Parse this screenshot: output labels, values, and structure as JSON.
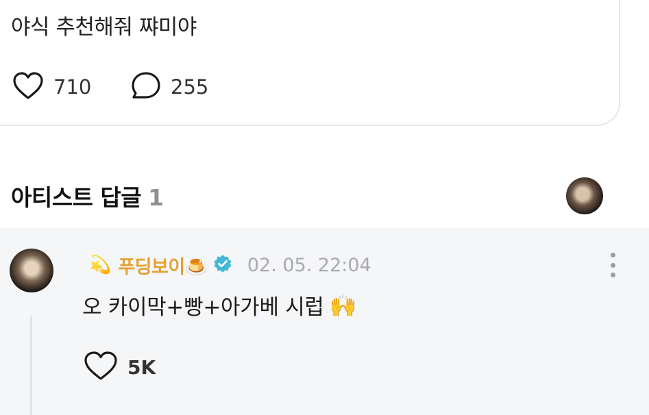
{
  "post": {
    "text": "야식 추천해줘 쨔미야",
    "likes": "710",
    "comments": "255"
  },
  "section": {
    "title": "아티스트 답글",
    "count": "1"
  },
  "reply": {
    "badge_emoji": "💫",
    "nickname": "푸딩보이🍮",
    "timestamp": "02. 05. 22:04",
    "text": "오 카이막+빵+아가베 시럽",
    "text_emoji": "🙌",
    "likes": "5K"
  },
  "colors": {
    "nickname": "#e3a133",
    "verified": "#3fb9d6",
    "reply_background": "#f5f6f8",
    "muted": "#a7a9ad"
  },
  "icons": [
    "heart-icon",
    "comment-bubble-icon",
    "verified-badge-icon",
    "more-vertical-icon"
  ]
}
